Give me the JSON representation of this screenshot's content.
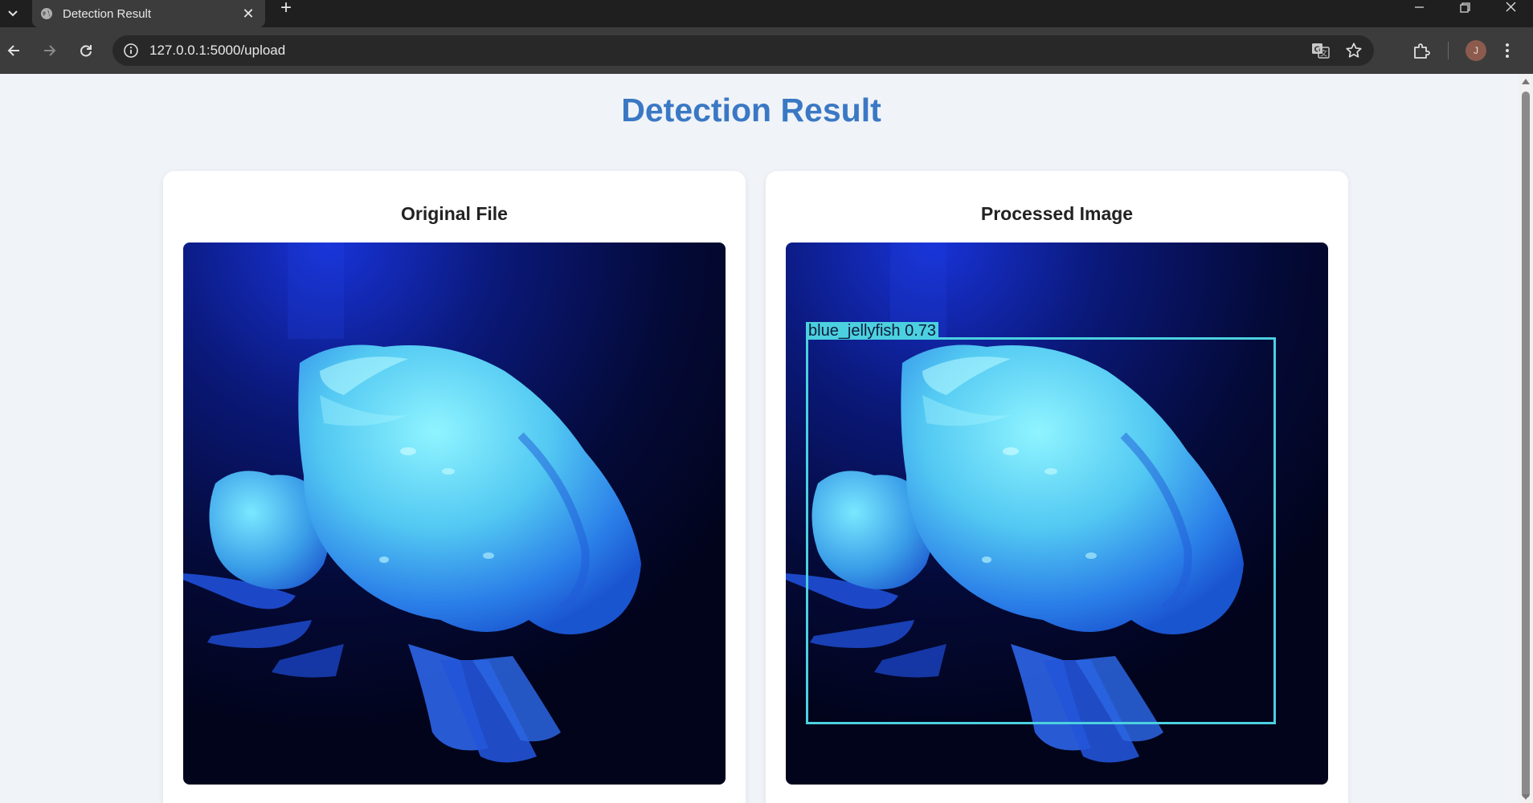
{
  "browser": {
    "tab_title": "Detection Result",
    "tab_close": "✕",
    "new_tab": "+",
    "url": "127.0.0.1:5000/upload",
    "profile_initial": "J"
  },
  "page": {
    "title": "Detection Result"
  },
  "cards": [
    {
      "title": "Original File"
    },
    {
      "title": "Processed Image"
    }
  ],
  "detection": {
    "label": "blue_jellyfish 0.73",
    "box_color": "#4cd0e0"
  },
  "colors": {
    "title_accent": "#3a78c4",
    "page_background": "#f0f3f7"
  }
}
